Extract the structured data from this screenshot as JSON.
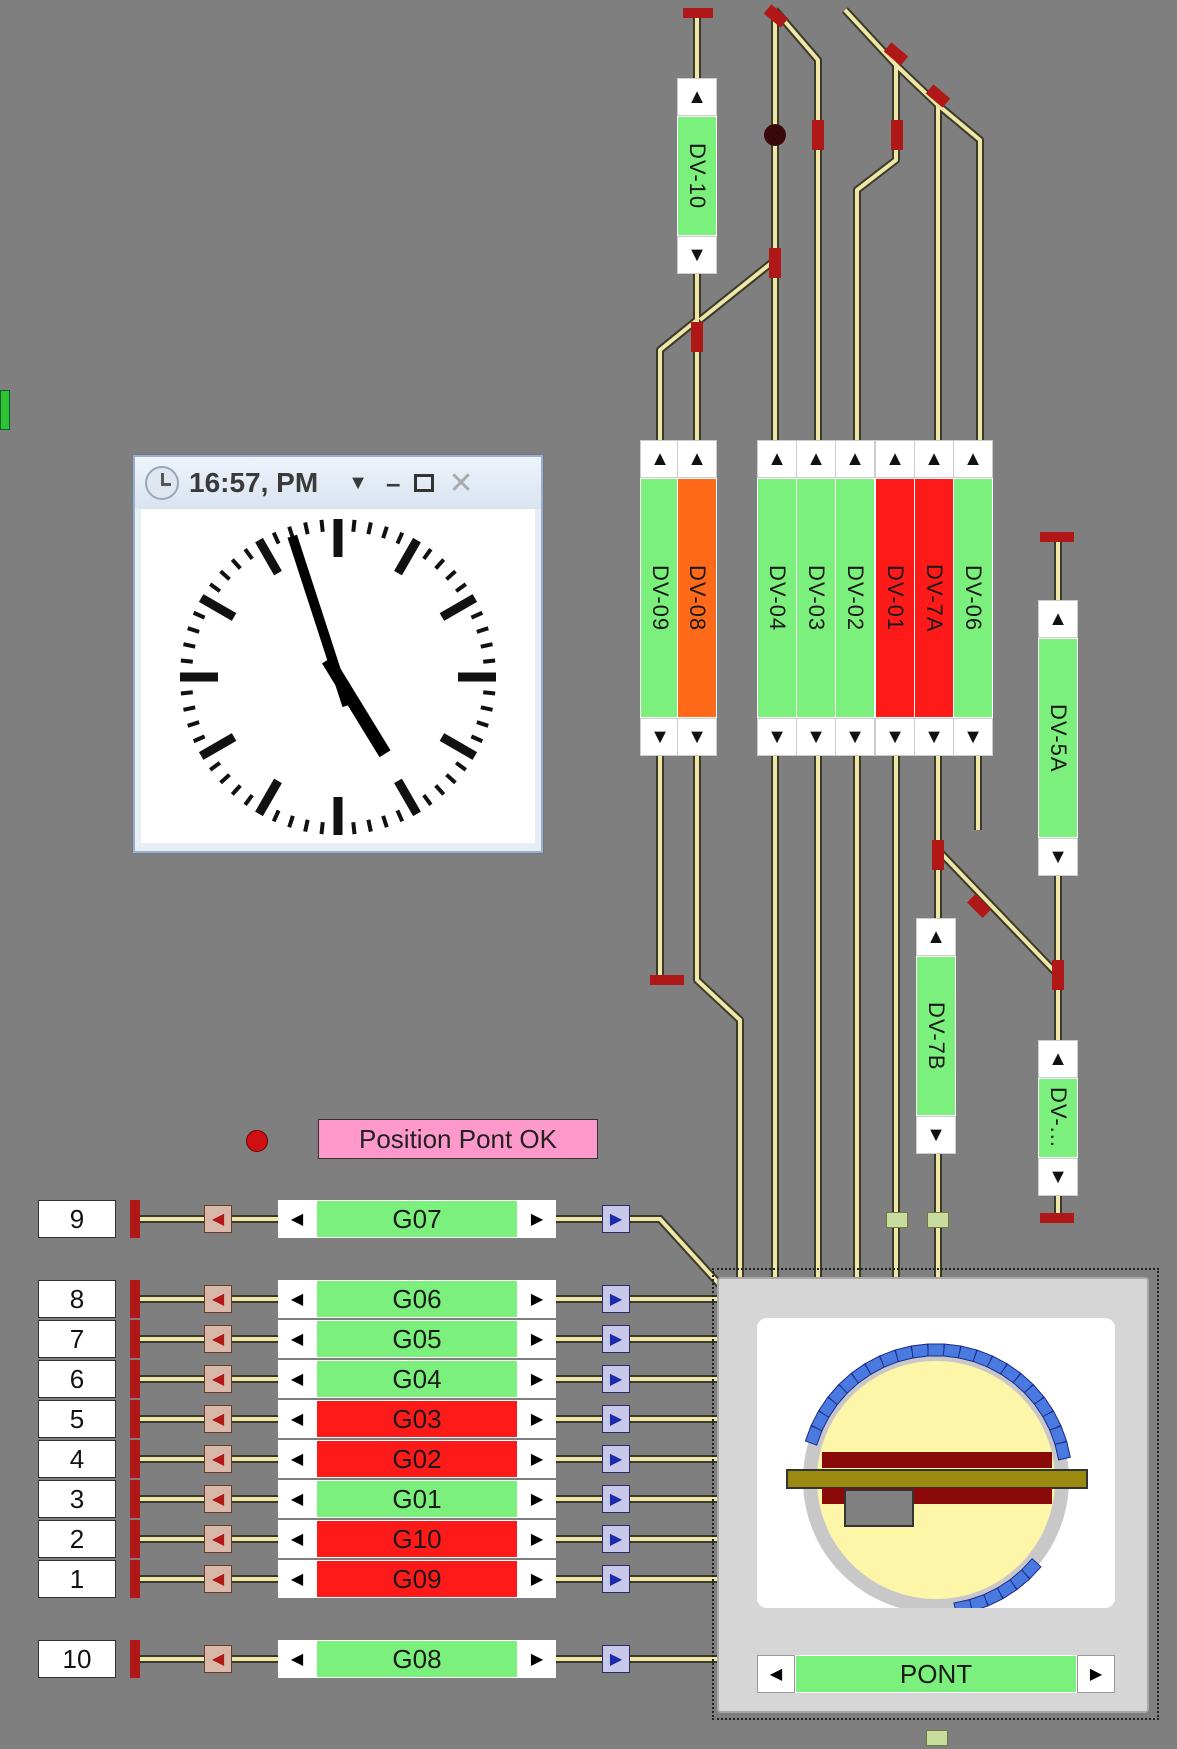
{
  "clock": {
    "title": "16:57, PM",
    "time_hours": 16,
    "time_minutes": 57,
    "icon": "clock-icon",
    "controls": [
      "chevron-down-icon",
      "minimize-icon",
      "maximize-icon",
      "close-icon"
    ]
  },
  "position_status": {
    "label": "Position Pont OK",
    "led_color": "#d01010"
  },
  "vertical_blocks": [
    {
      "label": "DV-10",
      "state": "free"
    },
    {
      "label": "DV-09",
      "state": "free"
    },
    {
      "label": "DV-08",
      "state": "occupied-orange"
    },
    {
      "label": "DV-04",
      "state": "free"
    },
    {
      "label": "DV-03",
      "state": "free"
    },
    {
      "label": "DV-02",
      "state": "free"
    },
    {
      "label": "DV-01",
      "state": "occupied"
    },
    {
      "label": "DV-7A",
      "state": "occupied"
    },
    {
      "label": "DV-06",
      "state": "free"
    },
    {
      "label": "DV-5A",
      "state": "free"
    },
    {
      "label": "DV-7B",
      "state": "free"
    },
    {
      "label": "DV-...",
      "state": "free"
    }
  ],
  "turntable_tracks": [
    {
      "number": "9",
      "block": "G07",
      "state": "free"
    },
    {
      "number": "8",
      "block": "G06",
      "state": "free"
    },
    {
      "number": "7",
      "block": "G05",
      "state": "free"
    },
    {
      "number": "6",
      "block": "G04",
      "state": "free"
    },
    {
      "number": "5",
      "block": "G03",
      "state": "occupied"
    },
    {
      "number": "4",
      "block": "G02",
      "state": "occupied"
    },
    {
      "number": "3",
      "block": "G01",
      "state": "free"
    },
    {
      "number": "2",
      "block": "G10",
      "state": "occupied"
    },
    {
      "number": "1",
      "block": "G09",
      "state": "occupied"
    },
    {
      "number": "10",
      "block": "G08",
      "state": "free"
    }
  ],
  "turntable": {
    "label": "PONT"
  },
  "colors": {
    "background": "#7f7f7f",
    "free": "#7cf07c",
    "occupied": "#ff1a1a",
    "occupied_orange": "#ff6a1a",
    "track": "#efe6a8",
    "stopper": "#b01818"
  }
}
